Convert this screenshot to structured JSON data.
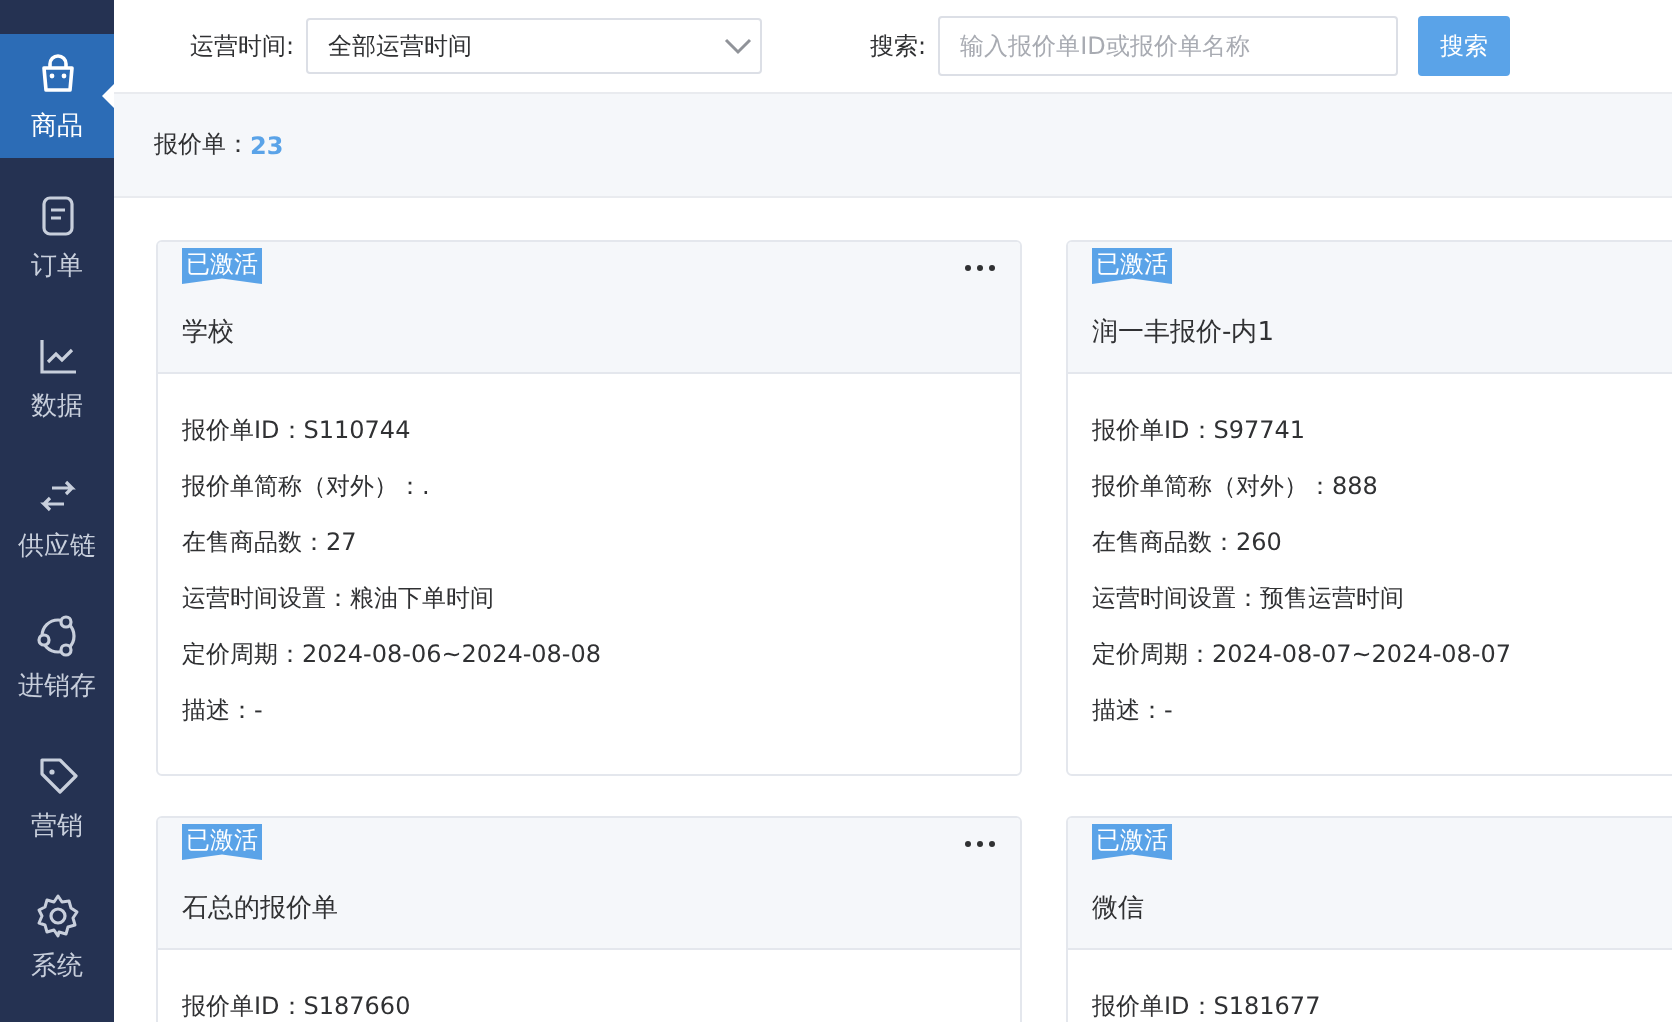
{
  "sidebar": {
    "items": [
      {
        "label": "商品",
        "selected": true
      },
      {
        "label": "订单",
        "selected": false
      },
      {
        "label": "数据",
        "selected": false
      },
      {
        "label": "供应链",
        "selected": false
      },
      {
        "label": "进销存",
        "selected": false
      },
      {
        "label": "营销",
        "selected": false
      },
      {
        "label": "系统",
        "selected": false
      }
    ]
  },
  "filters": {
    "time_label": "运营时间:",
    "time_value": "全部运营时间",
    "search_label": "搜索:",
    "search_placeholder": "输入报价单ID或报价单名称",
    "search_button": "搜索"
  },
  "summary": {
    "label": "报价单：",
    "count": "23"
  },
  "cards": [
    {
      "badge": "已激活",
      "title": "学校",
      "menu": true,
      "fields": [
        "报价单ID：S110744",
        "报价单简称（对外）：.",
        "在售商品数：27",
        "运营时间设置：粮油下单时间",
        "定价周期：2024-08-06~2024-08-08",
        "描述：-"
      ]
    },
    {
      "badge": "已激活",
      "title": "润一丰报价-内1",
      "menu": false,
      "fields": [
        "报价单ID：S97741",
        "报价单简称（对外）：888",
        "在售商品数：260",
        "运营时间设置：预售运营时间",
        "定价周期：2024-08-07~2024-08-07",
        "描述：-"
      ]
    },
    {
      "badge": "已激活",
      "title": "石总的报价单",
      "menu": true,
      "fields": [
        "报价单ID：S187660"
      ]
    },
    {
      "badge": "已激活",
      "title": "微信",
      "menu": false,
      "fields": [
        "报价单ID：S181677"
      ]
    }
  ]
}
